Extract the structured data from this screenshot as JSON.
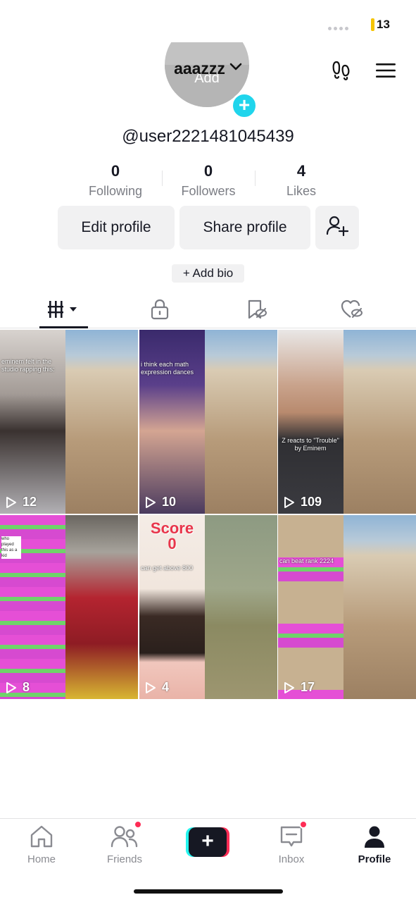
{
  "status": {
    "battery": "13"
  },
  "header": {
    "username": "aaazzz"
  },
  "avatar": {
    "add_label": "Add"
  },
  "profile": {
    "handle": "@user2221481045439"
  },
  "stats": [
    {
      "value": "0",
      "label": "Following"
    },
    {
      "value": "0",
      "label": "Followers"
    },
    {
      "value": "4",
      "label": "Likes"
    }
  ],
  "actions": {
    "edit": "Edit profile",
    "share": "Share profile"
  },
  "bio": {
    "add": "+ Add bio"
  },
  "videos": [
    {
      "views": "12",
      "caption": "eminem felt in the studio rapping this:"
    },
    {
      "views": "10",
      "caption": "i think each math expression dances"
    },
    {
      "views": "109",
      "caption": "Z reacts to \"Trouble\" by Eminem"
    },
    {
      "views": "8",
      "caption": "who played this as a kid"
    },
    {
      "views": "4",
      "caption": "can get above 800",
      "score_title": "Score",
      "score_value": "0"
    },
    {
      "views": "17",
      "caption": "can beat rank 2224"
    }
  ],
  "nav": {
    "home": "Home",
    "friends": "Friends",
    "inbox": "Inbox",
    "profile": "Profile"
  },
  "colors": {
    "accent_cyan": "#20d5ec",
    "notification_red": "#fe2c55",
    "text_primary": "#161823",
    "text_secondary": "#7b7d84",
    "button_bg": "#f1f1f2"
  }
}
